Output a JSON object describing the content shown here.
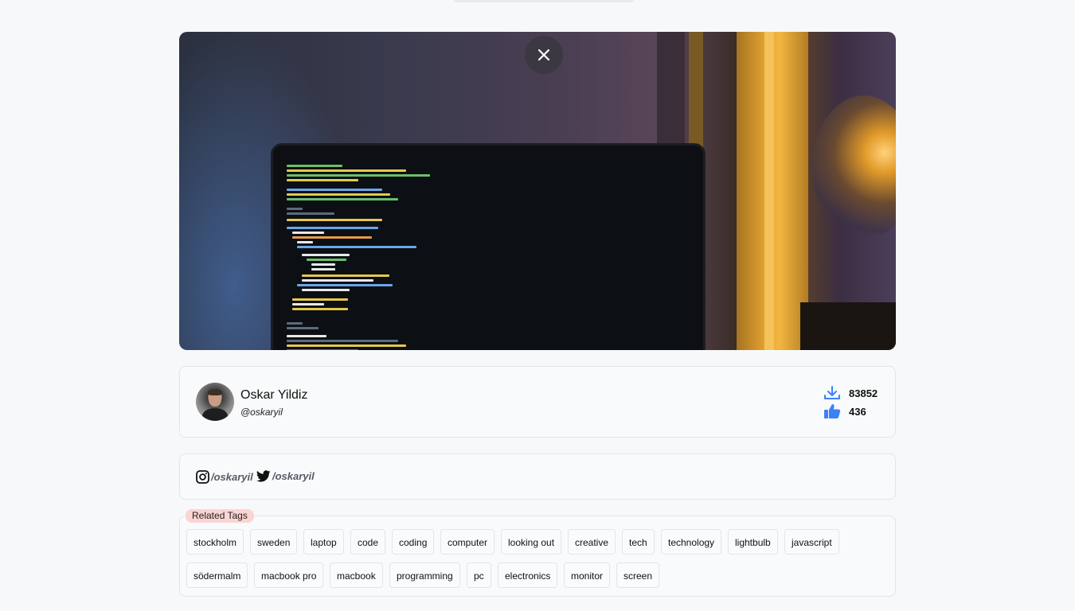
{
  "photo": {
    "close_icon": "close-icon",
    "alt": "laptop with code on screen next to a lightbulb"
  },
  "author": {
    "name": "Oskar Yildiz",
    "handle": "@oskaryil",
    "downloads": "83852",
    "likes": "436",
    "downloads_icon": "download-icon",
    "likes_icon": "thumbs-up-icon"
  },
  "social": {
    "instagram": "/oskaryil",
    "twitter": "/oskaryil"
  },
  "tags": {
    "label": "Related Tags",
    "items": [
      "stockholm",
      "sweden",
      "laptop",
      "code",
      "coding",
      "computer",
      "looking out",
      "creative",
      "tech",
      "technology",
      "lightbulb",
      "javascript",
      "södermalm",
      "macbook pro",
      "macbook",
      "programming",
      "pc",
      "electronics",
      "monitor",
      "screen"
    ]
  },
  "colors": {
    "accent": "#3b82f6",
    "tag_label_bg": "#fbd4d4"
  }
}
